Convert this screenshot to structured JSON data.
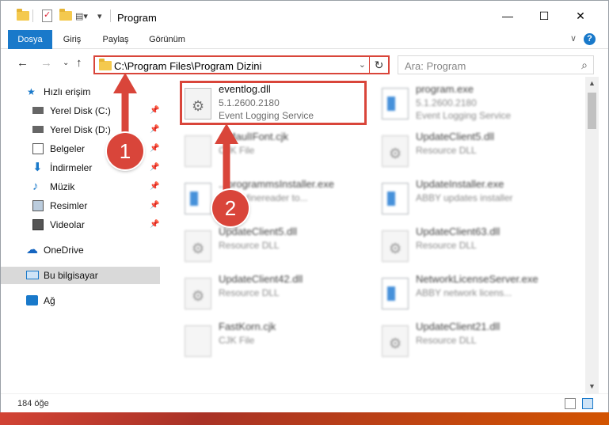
{
  "window": {
    "title": "Program"
  },
  "ribbon": {
    "tabs": [
      {
        "label": "Dosya",
        "active": true
      },
      {
        "label": "Giriş"
      },
      {
        "label": "Paylaş"
      },
      {
        "label": "Görünüm"
      }
    ]
  },
  "address": {
    "path": "C:\\Program Files\\Program Dizini"
  },
  "search": {
    "placeholder": "Ara: Program"
  },
  "sidebar": {
    "items": [
      {
        "label": "Hızlı erişim",
        "icon": "star-icon"
      },
      {
        "label": "Yerel Disk (C:)",
        "icon": "drive-icon",
        "pinned": true
      },
      {
        "label": "Yerel Disk (D:)",
        "icon": "drive-icon",
        "pinned": true
      },
      {
        "label": "Belgeler",
        "icon": "documents-icon",
        "pinned": true
      },
      {
        "label": "İndirmeler",
        "icon": "download-icon",
        "pinned": true
      },
      {
        "label": "Müzik",
        "icon": "music-icon",
        "pinned": true
      },
      {
        "label": "Resimler",
        "icon": "pictures-icon",
        "pinned": true
      },
      {
        "label": "Videolar",
        "icon": "videos-icon",
        "pinned": true
      },
      {
        "label": "OneDrive",
        "icon": "cloud-icon"
      },
      {
        "label": "Bu bilgisayar",
        "icon": "computer-icon",
        "selected": true
      },
      {
        "label": "Ağ",
        "icon": "network-icon"
      }
    ]
  },
  "files": [
    {
      "name": "eventlog.dll",
      "line2": "5.1.2600.2180",
      "line3": "Event Logging Service",
      "highlighted": true
    },
    {
      "name": "program.exe",
      "line2": "5.1.2600.2180",
      "line3": "Event Logging Service"
    },
    {
      "name": "...MaulIFont.cjk",
      "line2": "CJK File",
      "line3": ""
    },
    {
      "name": "UpdateClient5.dll",
      "line2": "Resource DLL",
      "line3": ""
    },
    {
      "name": "...programmsInstaller.exe",
      "line2": "ABBY finereader to...",
      "line3": ""
    },
    {
      "name": "UpdateInstaller.exe",
      "line2": "ABBY updates installer",
      "line3": ""
    },
    {
      "name": "UpdateClient5.dll",
      "line2": "Resource DLL",
      "line3": ""
    },
    {
      "name": "UpdateClient63.dll",
      "line2": "Resource DLL",
      "line3": ""
    },
    {
      "name": "UpdateClient42.dll",
      "line2": "Resource DLL",
      "line3": ""
    },
    {
      "name": "NetworkLicenseServer.exe",
      "line2": "ABBY network licens...",
      "line3": ""
    },
    {
      "name": "FastKorn.cjk",
      "line2": "CJK File",
      "line3": ""
    },
    {
      "name": "UpdateClient21.dll",
      "line2": "Resource DLL",
      "line3": ""
    }
  ],
  "status": {
    "item_count": "184 öğe"
  },
  "annotations": {
    "step1": "1",
    "step2": "2"
  },
  "colors": {
    "accent": "#1979ca",
    "highlight": "#d9453a"
  }
}
